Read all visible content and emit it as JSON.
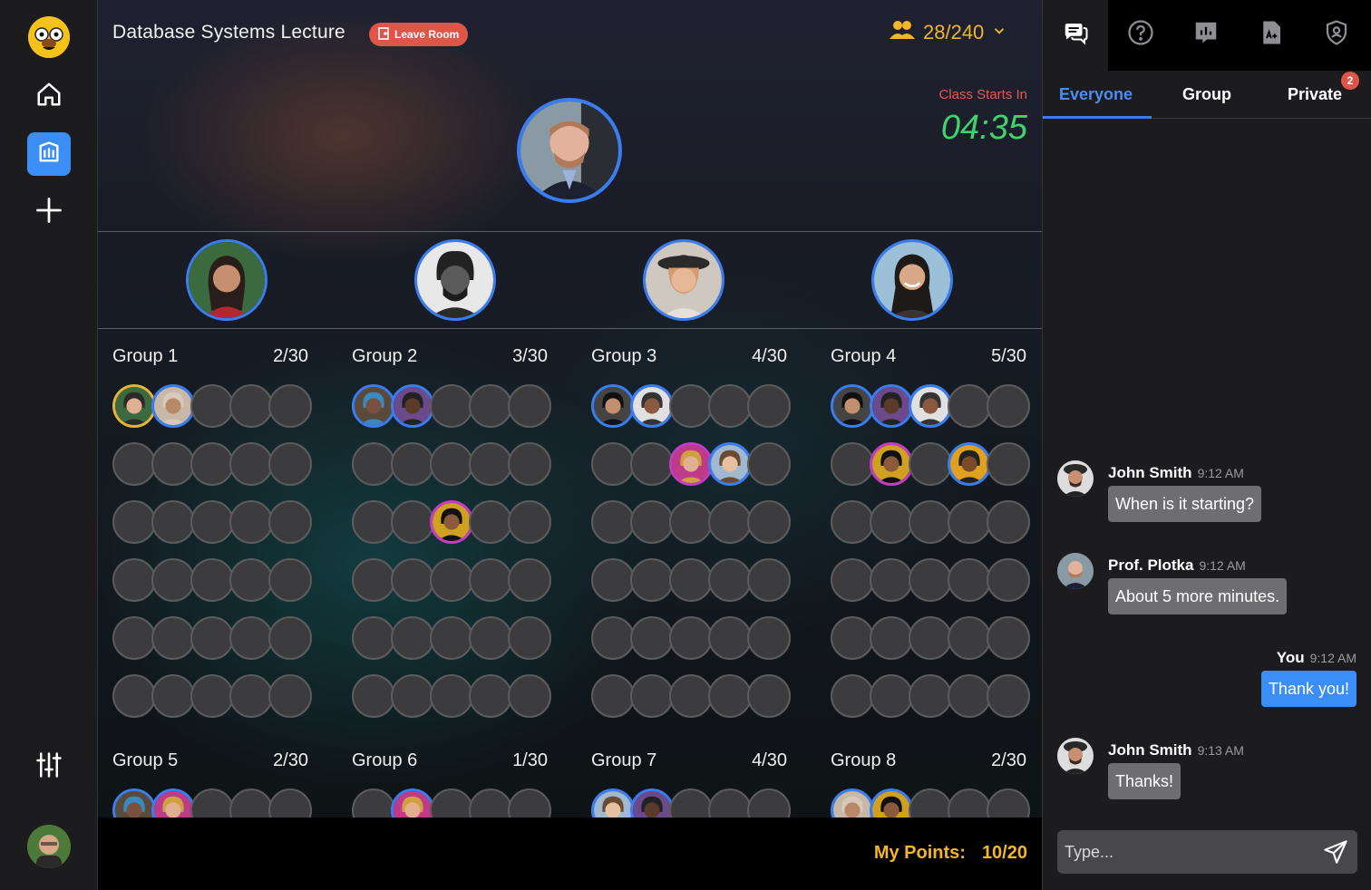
{
  "rail": {
    "items": [
      {
        "name": "home",
        "icon": "home-icon",
        "active": false
      },
      {
        "name": "rooms",
        "icon": "room-icon",
        "active": true
      },
      {
        "name": "add",
        "icon": "plus-icon",
        "active": false
      }
    ],
    "bottom_icon": "settings-sliders-icon"
  },
  "header": {
    "room_title": "Database Systems Lecture",
    "leave_label": "Leave Room",
    "attendance": "28/240"
  },
  "countdown": {
    "label": "Class Starts In",
    "time": "04:35"
  },
  "groups": [
    {
      "name": "Group 1",
      "count": "2/30"
    },
    {
      "name": "Group 2",
      "count": "3/30"
    },
    {
      "name": "Group 3",
      "count": "4/30"
    },
    {
      "name": "Group 4",
      "count": "5/30"
    },
    {
      "name": "Group 5",
      "count": "2/30"
    },
    {
      "name": "Group 6",
      "count": "1/30"
    },
    {
      "name": "Group 7",
      "count": "4/30"
    },
    {
      "name": "Group 8",
      "count": "2/30"
    }
  ],
  "points": {
    "label": "My Points:",
    "value": "10/20"
  },
  "chat": {
    "tabs": [
      {
        "label": "Everyone",
        "active": true
      },
      {
        "label": "Group",
        "active": false
      },
      {
        "label": "Private",
        "active": false
      }
    ],
    "private_badge": "2",
    "messages": [
      {
        "name": "John Smith",
        "time": "9:12 AM",
        "text": "When is it starting?",
        "mine": false
      },
      {
        "name": "Prof. Plotka",
        "time": "9:12 AM",
        "text": "About 5 more minutes.",
        "mine": false
      },
      {
        "name": "You",
        "time": "9:12 AM",
        "text": "Thank you!",
        "mine": true
      },
      {
        "name": "John Smith",
        "time": "9:13 AM",
        "text": "Thanks!",
        "mine": false
      }
    ],
    "input_placeholder": "Type..."
  },
  "colors": {
    "accent": "#3a8ef6",
    "gold": "#f3b52a",
    "danger": "#e0554a",
    "success": "#3fd46b"
  }
}
